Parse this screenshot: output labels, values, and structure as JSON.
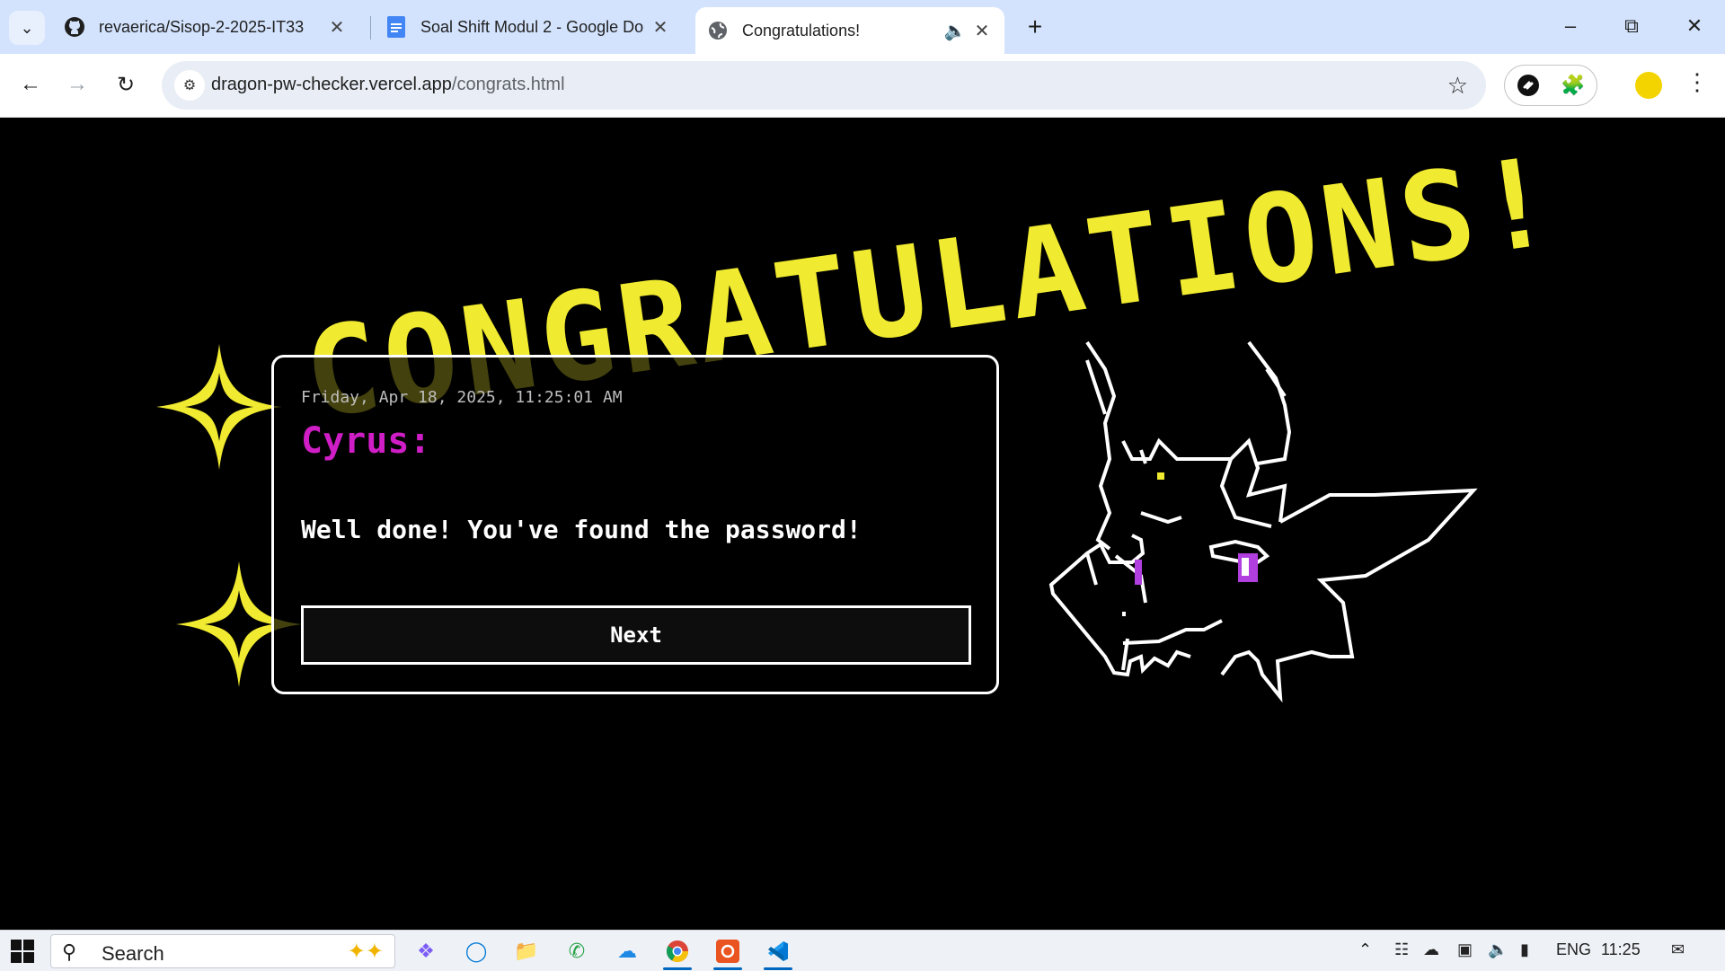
{
  "tabs": [
    {
      "title": "revaerica/Sisop-2-2025-IT33",
      "icon": "github-icon"
    },
    {
      "title": "Soal Shift Modul 2 - Google Do",
      "icon": "google-docs-icon"
    },
    {
      "title": "Congratulations!",
      "icon": "globe-icon",
      "active": true,
      "audio": true
    }
  ],
  "address_bar": {
    "host": "dragon-pw-checker.vercel.app",
    "path": "/congrats.html"
  },
  "page": {
    "banner": "CONGRATULATIONS!",
    "dialog": {
      "timestamp": "Friday, Apr 18, 2025, 11:25:01 AM",
      "speaker": "Cyrus:",
      "message": "Well done! You've found the password!",
      "next_label": "Next"
    },
    "colors": {
      "accent_yellow": "#f0ea30",
      "speaker_magenta": "#d01ec7",
      "dragon_eye": "#b13fe0"
    }
  },
  "taskbar": {
    "search_label": "Search",
    "language": "ENG",
    "time": "11:25",
    "apps": [
      "copilot-icon",
      "edge-icon",
      "file-explorer-icon",
      "whatsapp-icon",
      "onedrive-icon",
      "chrome-icon",
      "ubuntu-icon",
      "vscode-icon"
    ]
  }
}
